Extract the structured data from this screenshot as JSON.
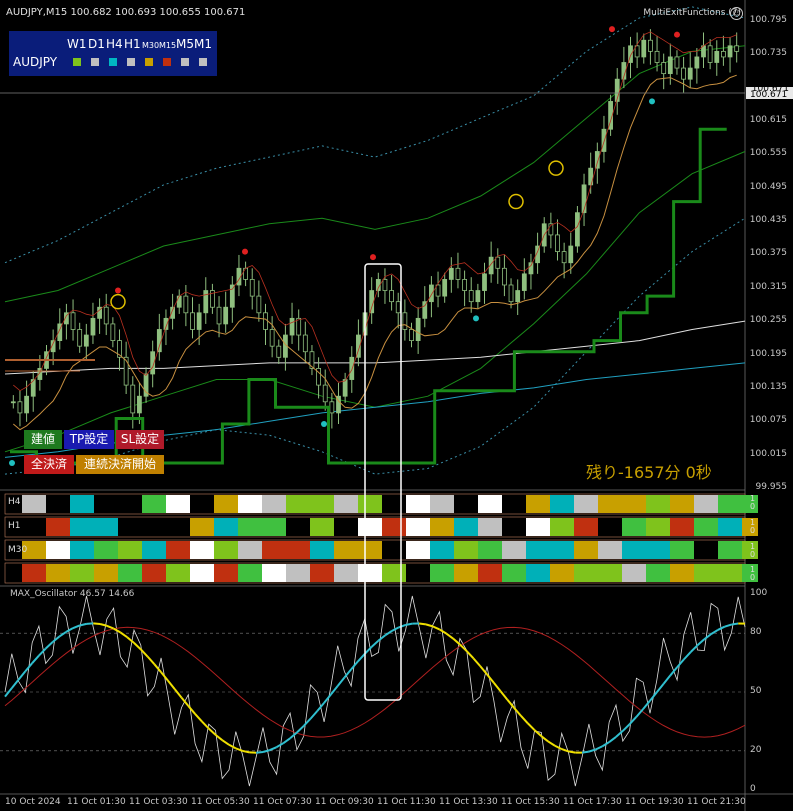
{
  "chart_data": {
    "type": "line",
    "instrument": "AUDJPY",
    "timeframe": "M15",
    "ohlc_header": "100.682 100.693 100.655 100.671",
    "current_price": "100.671",
    "price_axis": [
      "100.795",
      "100.735",
      "100.671",
      "100.615",
      "100.555",
      "100.495",
      "100.435",
      "100.375",
      "100.315",
      "100.255",
      "100.195",
      "100.135",
      "100.075",
      "100.015",
      "99.955"
    ],
    "ylim": [
      99.955,
      100.8
    ],
    "time_axis": [
      "10 Oct 2024",
      "11 Oct 01:30",
      "11 Oct 03:30",
      "11 Oct 05:30",
      "11 Oct 07:30",
      "11 Oct 09:30",
      "11 Oct 11:30",
      "11 Oct 13:30",
      "11 Oct 15:30",
      "11 Oct 17:30",
      "11 Oct 19:30",
      "11 Oct 21:30"
    ],
    "candles_close_approx": [
      100.11,
      100.09,
      100.12,
      100.15,
      100.17,
      100.2,
      100.22,
      100.25,
      100.27,
      100.24,
      100.21,
      100.23,
      100.26,
      100.28,
      100.25,
      100.22,
      100.19,
      100.14,
      100.09,
      100.12,
      100.16,
      100.2,
      100.24,
      100.26,
      100.28,
      100.3,
      100.27,
      100.24,
      100.27,
      100.31,
      100.28,
      100.25,
      100.28,
      100.32,
      100.35,
      100.33,
      100.3,
      100.27,
      100.24,
      100.21,
      100.19,
      100.23,
      100.26,
      100.23,
      100.2,
      100.17,
      100.14,
      100.11,
      100.09,
      100.12,
      100.15,
      100.19,
      100.23,
      100.27,
      100.31,
      100.33,
      100.31,
      100.29,
      100.27,
      100.24,
      100.22,
      100.26,
      100.29,
      100.32,
      100.3,
      100.33,
      100.35,
      100.33,
      100.31,
      100.29,
      100.31,
      100.34,
      100.37,
      100.35,
      100.32,
      100.29,
      100.31,
      100.34,
      100.36,
      100.39,
      100.43,
      100.41,
      100.38,
      100.36,
      100.39,
      100.45,
      100.5,
      100.53,
      100.56,
      100.6,
      100.65,
      100.69,
      100.72,
      100.75,
      100.73,
      100.76,
      100.74,
      100.72,
      100.7,
      100.73,
      100.71,
      100.69,
      100.71,
      100.73,
      100.75,
      100.72,
      100.74,
      100.73,
      100.75,
      100.74
    ],
    "series": [
      {
        "name": "upper-band-outer",
        "values": [
          100.36,
          100.4,
          100.45,
          100.5,
          100.53,
          100.55,
          100.57,
          100.55,
          100.58,
          100.62,
          100.66,
          100.74,
          100.8,
          100.82,
          100.8
        ]
      },
      {
        "name": "upper-band-inner",
        "values": [
          100.29,
          100.31,
          100.35,
          100.39,
          100.41,
          100.43,
          100.44,
          100.42,
          100.44,
          100.48,
          100.54,
          100.62,
          100.7,
          100.74,
          100.75
        ]
      },
      {
        "name": "lower-band-inner",
        "values": [
          100.02,
          100.05,
          100.09,
          100.12,
          100.15,
          100.15,
          100.12,
          100.1,
          100.12,
          100.17,
          100.25,
          100.34,
          100.45,
          100.52,
          100.56
        ]
      },
      {
        "name": "lower-band-outer",
        "values": [
          99.98,
          99.99,
          100.01,
          100.04,
          100.06,
          100.05,
          100.02,
          99.98,
          99.99,
          100.03,
          100.1,
          100.2,
          100.3,
          100.38,
          100.44
        ]
      },
      {
        "name": "ma-white",
        "values": [
          100.16,
          100.165,
          100.17,
          100.17,
          100.175,
          100.18,
          100.18,
          100.18,
          100.185,
          100.19,
          100.2,
          100.21,
          100.22,
          100.24,
          100.255
        ]
      },
      {
        "name": "ma-cyan",
        "values": [
          100.01,
          100.02,
          100.035,
          100.05,
          100.06,
          100.075,
          100.09,
          100.1,
          100.11,
          100.125,
          100.135,
          100.15,
          100.16,
          100.17,
          100.18
        ]
      }
    ],
    "markers": {
      "red_dots_at": [
        100.31,
        100.38,
        100.37,
        100.78,
        100.77
      ],
      "cyan_dots_at": [
        100.0,
        100.07,
        100.26,
        100.65
      ],
      "yellow_circles_at": [
        100.29,
        100.47,
        100.53
      ]
    }
  },
  "top": {
    "symbol_label": "AUDJPY,M15  100.682 100.693 100.655 100.671",
    "indicator_name": "MultiExitFunctions (7)"
  },
  "tf_panel": {
    "items": [
      "W1",
      "D1",
      "H4",
      "H1",
      "M30",
      "M15",
      "M5",
      "M1"
    ],
    "symbol": "AUDJPY",
    "square_colors": [
      "#7fc31c",
      "#c0c0c0",
      "#00b7c3",
      "#c0c0c0",
      "#c8a000",
      "#c03010",
      "#c0c0c0",
      "#c0c0c0"
    ]
  },
  "buttons": {
    "entry": "建値",
    "tp_settings": "TP設定",
    "sl_settings": "SL設定",
    "close_all": "全決済",
    "continuous_close": "連続決済開始"
  },
  "countdown": "残り-1657分 0秒",
  "mtf_rows": [
    "H4",
    "H1",
    "M30",
    ""
  ],
  "mtf_right_labels": [
    "1\n0",
    "1\n0",
    "1\n0",
    "1\n0"
  ],
  "oscillator": {
    "label": "MAX_Oscillator 46.57 14.66",
    "levels": [
      "100",
      "80",
      "50",
      "20",
      "0"
    ]
  },
  "colors": {
    "bull_candle": "#8fbf7f",
    "bear_candle": "#8fbf7f",
    "band": "#3a8fa8",
    "green_ma": "#1a8a1a",
    "orange_ma": "#c89040",
    "red_ma": "#b83020",
    "cyan_ma": "#20a0c0",
    "white_ma": "#e0e0e0",
    "yellow_osc": "#f0e000",
    "teal_osc": "#30c0d0"
  }
}
